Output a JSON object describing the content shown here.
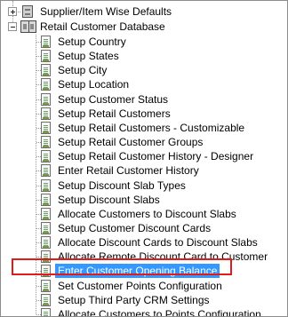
{
  "tree": {
    "partial_top_item": "",
    "supplier_item": "Supplier/Item Wise Defaults",
    "retail_db": "Retail Customer Database",
    "children": [
      "Setup Country",
      "Setup States",
      "Setup City",
      "Setup Location",
      "Setup Customer Status",
      "Setup Retail Customers",
      "Setup Retail Customers - Customizable",
      "Setup Retail Customer Groups",
      "Setup Retail Customer History - Designer",
      "Enter Retail Customer History",
      "Setup Discount Slab Types",
      "Setup Discount Slabs",
      "Allocate Customers to Discount Slabs",
      "Setup Customer Discount Cards",
      "Allocate Discount Cards to Discount Slabs",
      "Allocate Remote Discount Card to Customer",
      "Enter Customer Opening Balance",
      "Set Customer Points Configuration",
      "Setup Third Party CRM Settings",
      "Allocate Customers to Points Configuration"
    ],
    "selected_index": 16
  }
}
